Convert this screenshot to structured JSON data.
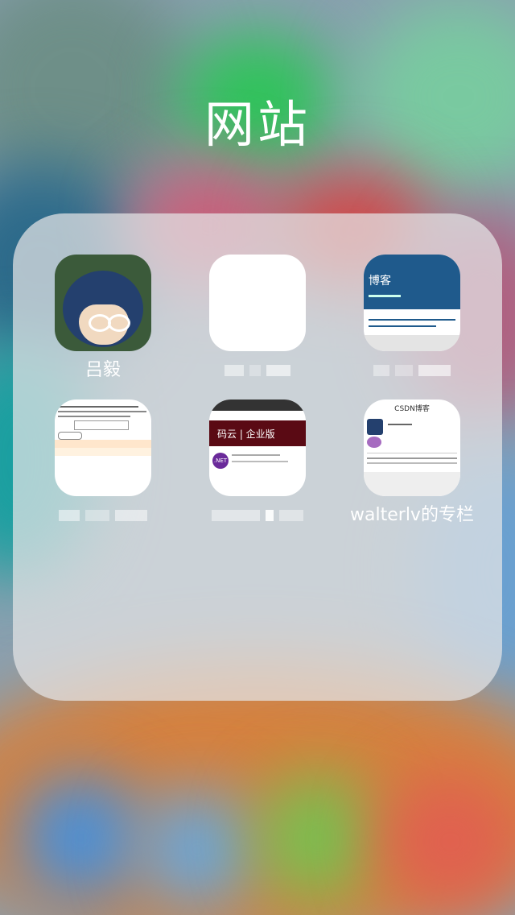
{
  "folder": {
    "title": "网站"
  },
  "apps": [
    {
      "id": "luyi",
      "label": "吕毅",
      "icon": "anime-avatar-icon"
    },
    {
      "id": "blank",
      "label": "",
      "icon": "blank-web-icon"
    },
    {
      "id": "blog",
      "label": "",
      "icon": "blog-page-icon",
      "icon_title": "博客"
    },
    {
      "id": "forum",
      "label": "",
      "icon": "forum-page-icon"
    },
    {
      "id": "gitee",
      "label": "",
      "icon": "gitee-page-icon",
      "icon_brand": "码云 | 企业版",
      "icon_tag": ".NET"
    },
    {
      "id": "csdn",
      "label": "walterlv的专栏",
      "icon": "csdn-page-icon",
      "icon_title": "CSDN博客"
    }
  ]
}
